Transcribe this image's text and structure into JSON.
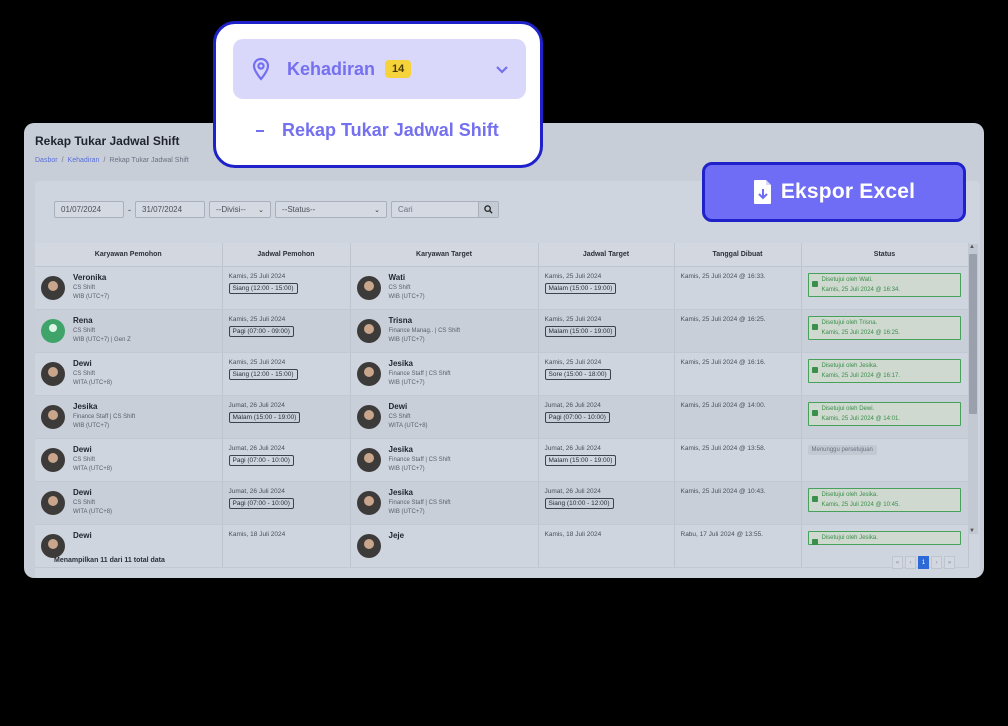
{
  "page": {
    "title": "Rekap Tukar Jadwal Shift",
    "breadcrumb": [
      "Dasbor",
      "Kehadiran",
      "Rekap Tukar Jadwal Shift"
    ]
  },
  "filters": {
    "date_from": "01/07/2024",
    "date_sep": "-",
    "date_to": "31/07/2024",
    "divisi": "--Divisi--",
    "status": "--Status--",
    "search_placeholder": "Cari"
  },
  "table": {
    "headers": [
      "Karyawan Pemohon",
      "Jadwal Pemohon",
      "Karyawan Target",
      "Jadwal Target",
      "Tanggal Dibuat",
      "Status"
    ],
    "rows": [
      {
        "req_name": "Veronika",
        "req_pos": "CS Shift",
        "req_tz": "WIB (UTC+7)",
        "req_date": "Kamis, 25 Juli 2024",
        "req_shift": "Siang (12:00 - 15:00)",
        "tgt_name": "Wati",
        "tgt_pos": "CS Shift",
        "tgt_tz": "WIB (UTC+7)",
        "tgt_date": "Kamis, 25 Juli 2024",
        "tgt_shift": "Malam (15:00 - 19:00)",
        "created": "Kamis, 25 Juli 2024 @ 16:33.",
        "status1": "Disetujui oleh Wati.",
        "status2": "Kamis, 25 Juli 2024 @ 16:34."
      },
      {
        "req_name": "Rena",
        "req_pos": "CS Shift",
        "req_tz": "WIB (UTC+7) | Gen Z",
        "req_date": "Kamis, 25 Juli 2024",
        "req_shift": "Pagi (07:00 - 09:00)",
        "tgt_name": "Trisna",
        "tgt_pos": "Finance Manag.. | CS Shift",
        "tgt_tz": "WIB (UTC+7)",
        "tgt_date": "Kamis, 25 Juli 2024",
        "tgt_shift": "Malam (15:00 - 19:00)",
        "created": "Kamis, 25 Juli 2024 @ 16:25.",
        "status1": "Disetujui oleh Trisna.",
        "status2": "Kamis, 25 Juli 2024 @ 16:25."
      },
      {
        "req_name": "Dewi",
        "req_pos": "CS Shift",
        "req_tz": "WITA (UTC+8)",
        "req_date": "Kamis, 25 Juli 2024",
        "req_shift": "Siang (12:00 - 15:00)",
        "tgt_name": "Jesika",
        "tgt_pos": "Finance Staff | CS Shift",
        "tgt_tz": "WIB (UTC+7)",
        "tgt_date": "Kamis, 25 Juli 2024",
        "tgt_shift": "Sore (15:00 - 18:00)",
        "created": "Kamis, 25 Juli 2024 @ 16:16.",
        "status1": "Disetujui oleh Jesika.",
        "status2": "Kamis, 25 Juli 2024 @ 16:17."
      },
      {
        "req_name": "Jesika",
        "req_pos": "Finance Staff | CS Shift",
        "req_tz": "WIB (UTC+7)",
        "req_date": "Jumat, 26 Juli 2024",
        "req_shift": "Malam (15:00 - 19:00)",
        "tgt_name": "Dewi",
        "tgt_pos": "CS Shift",
        "tgt_tz": "WITA (UTC+8)",
        "tgt_date": "Jumat, 26 Juli 2024",
        "tgt_shift": "Pagi (07:00 - 10:00)",
        "created": "Kamis, 25 Juli 2024 @ 14:00.",
        "status1": "Disetujui oleh Dewi.",
        "status2": "Kamis, 25 Juli 2024 @ 14:01."
      },
      {
        "req_name": "Dewi",
        "req_pos": "CS Shift",
        "req_tz": "WITA (UTC+8)",
        "req_date": "Jumat, 26 Juli 2024",
        "req_shift": "Pagi (07:00 - 10:00)",
        "tgt_name": "Jesika",
        "tgt_pos": "Finance Staff | CS Shift",
        "tgt_tz": "WIB (UTC+7)",
        "tgt_date": "Jumat, 26 Juli 2024",
        "tgt_shift": "Malam (15:00 - 19:00)",
        "created": "Kamis, 25 Juli 2024 @ 13:58.",
        "status1": "Menunggu persetujuan",
        "status2": ""
      },
      {
        "req_name": "Dewi",
        "req_pos": "CS Shift",
        "req_tz": "WITA (UTC+8)",
        "req_date": "Jumat, 26 Juli 2024",
        "req_shift": "Pagi (07:00 - 10:00)",
        "tgt_name": "Jesika",
        "tgt_pos": "Finance Staff | CS Shift",
        "tgt_tz": "WIB (UTC+7)",
        "tgt_date": "Jumat, 26 Juli 2024",
        "tgt_shift": "Siang (10:00 - 12:00)",
        "created": "Kamis, 25 Juli 2024 @ 10:43.",
        "status1": "Disetujui oleh Jesika.",
        "status2": "Kamis, 25 Juli 2024 @ 10:45."
      },
      {
        "req_name": "Dewi",
        "req_pos": "",
        "req_tz": "",
        "req_date": "Kamis, 18 Juli 2024",
        "req_shift": "",
        "tgt_name": "Jeje",
        "tgt_pos": "",
        "tgt_tz": "",
        "tgt_date": "Kamis, 18 Juli 2024",
        "tgt_shift": "",
        "created": "Rabu, 17 Juli 2024 @ 13:55.",
        "status1": "Disetujui oleh Jesika.",
        "status2": ""
      }
    ]
  },
  "footer": {
    "summary": "Menampilkan 11 dari 11 total data",
    "pager": [
      "«",
      "‹",
      "1",
      "›",
      "»"
    ]
  },
  "overlay": {
    "menu_label": "Kehadiran",
    "menu_badge": "14",
    "submenu_dash": "–",
    "submenu_label": "Rekap Tukar Jadwal Shift",
    "export_label": "Ekspor Excel"
  },
  "colors": {
    "accent": "#6f6cf5",
    "border_highlight": "#1e22c8",
    "badge": "#f6d33a",
    "approved": "#3a8f4a"
  }
}
